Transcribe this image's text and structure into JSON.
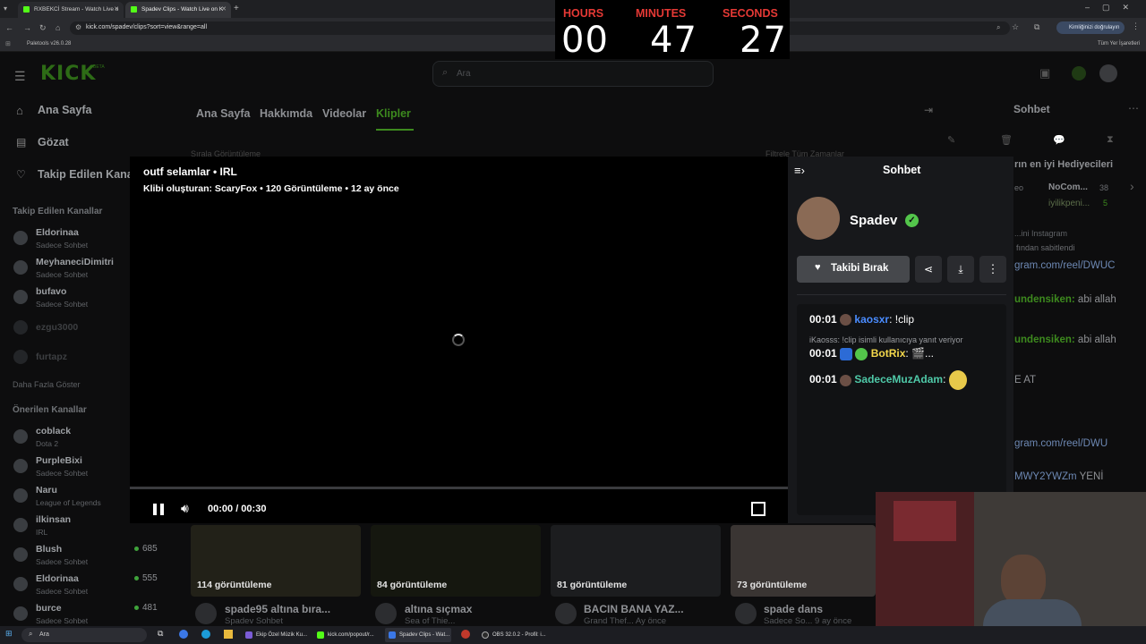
{
  "browser": {
    "tabs": [
      {
        "title": "RXBEKCİ Stream - Watch Live o",
        "active": false
      },
      {
        "title": "Spadev Clips - Watch Live on K",
        "active": true
      }
    ],
    "url": "kick.com/spadev/clips?sort=view&range=all",
    "bookmark": "Paletools v26.0.28",
    "bookmarks_right": "Tüm Yer İşaretleri",
    "profile_button": "Kimliğinizi doğrulayın"
  },
  "countdown": {
    "hours_label": "HOURS",
    "minutes_label": "MINUTES",
    "seconds_label": "SECONDS",
    "hours": "00",
    "minutes": "47",
    "seconds": "27"
  },
  "kick": {
    "logo": "KICK",
    "logo_tag": "BETA",
    "search_placeholder": "Ara",
    "nav": {
      "home": "Ana Sayfa",
      "browse": "Gözat",
      "following": "Takip Edilen Kanallar"
    },
    "followed_header": "Takip Edilen Kanallar",
    "followed": [
      {
        "name": "Eldorinaa",
        "sub": "Sadece Sohbet"
      },
      {
        "name": "MeyhaneciDimitri",
        "sub": "Sadece Sohbet"
      },
      {
        "name": "bufavo",
        "sub": "Sadece Sohbet"
      },
      {
        "name": "ezgu3000",
        "sub": ""
      },
      {
        "name": "furtapz",
        "sub": ""
      }
    ],
    "show_more": "Daha Fazla Göster",
    "recommended_header": "Önerilen Kanallar",
    "recommended": [
      {
        "name": "coblack",
        "sub": "Dota 2",
        "count": ""
      },
      {
        "name": "PurpleBixi",
        "sub": "Sadece Sohbet",
        "count": ""
      },
      {
        "name": "Naru",
        "sub": "League of Legends",
        "count": ""
      },
      {
        "name": "ilkinsan",
        "sub": "IRL",
        "count": ""
      },
      {
        "name": "Blush",
        "sub": "Sadece Sohbet",
        "count": "685"
      },
      {
        "name": "Eldorinaa",
        "sub": "Sadece Sohbet",
        "count": "555"
      },
      {
        "name": "burce",
        "sub": "Sadece Sohbet",
        "count": "481"
      }
    ],
    "channel_tabs": [
      "Ana Sayfa",
      "Hakkımda",
      "Videolar",
      "Klipler"
    ],
    "filters_left": "Sırala    Görüntüleme",
    "filters_right": "Filtrele    Tüm Zamanlar",
    "bg_chat": {
      "title": "Sohbet",
      "gifters": "rın en iyi Hediyecileri",
      "g1": "NoCom...",
      "g1n": "38",
      "g2": "iyilikpeni...",
      "g2n": "5",
      "g_left": "eo",
      "instagram": "...ini Instagram",
      "pinned_by": "fından sabitlendi",
      "pinned_link": "gram.com/reel/DWUC",
      "m1_user": "undensiken:",
      "m1": " abi allah",
      "m2_user": "undensiken:",
      "m2": " abi allah",
      "m3": "E AT",
      "m4": "gram.com/reel/DWU",
      "m5_link": "MWY2YWZm",
      "m5": " YENİ"
    },
    "clips": [
      {
        "views": "114 görüntüleme",
        "title": "spade95 altına bıra...",
        "sub": "Spadev Sohbet"
      },
      {
        "views": "84 görüntüleme",
        "title": "altına sıçmax",
        "sub": "Sea of Thie..."
      },
      {
        "views": "81 görüntüleme",
        "title": "BACIN BANA YAZ...",
        "sub": "Grand Thef...  Ay önce"
      },
      {
        "views": "73 görüntüleme",
        "title": "spade dans",
        "sub": "Sadece So...  9 ay önce"
      }
    ]
  },
  "clip_modal": {
    "title": "outf selamlar • IRL",
    "meta": "Klibi oluşturan: ScaryFox • 120 Görüntüleme • 12 ay önce",
    "time": "00:00 / 00:30",
    "progress": 0.0,
    "chat_title": "Sohbet",
    "streamer": "Spadev",
    "follow_button": "Takibi Bırak",
    "messages": [
      {
        "time": "00:01",
        "user": "kaosxr",
        "text": ": !clip",
        "color": "#4a8cff"
      },
      {
        "reply": "iKaosss: !clip isimli kullanıcıya yanıt veriyor",
        "time": "00:01",
        "user": "BotRix",
        "text": ": 🎬...",
        "color": "#f4d84c"
      },
      {
        "time": "00:01",
        "user": "SadeceMuzAdam",
        "text": ":",
        "color": "#4fc9a8"
      }
    ]
  },
  "taskbar": {
    "search": "Ara",
    "items": [
      "Ekip Özel Müzik Ku...",
      "kick.com/popout/r...",
      "Spadev Clips - Wat...",
      "OBS 32.0.2 - Profil: i..."
    ]
  },
  "colors": {
    "kick_green": "#53fc18",
    "accent_red": "#e53935",
    "verified": "#53c54b"
  }
}
